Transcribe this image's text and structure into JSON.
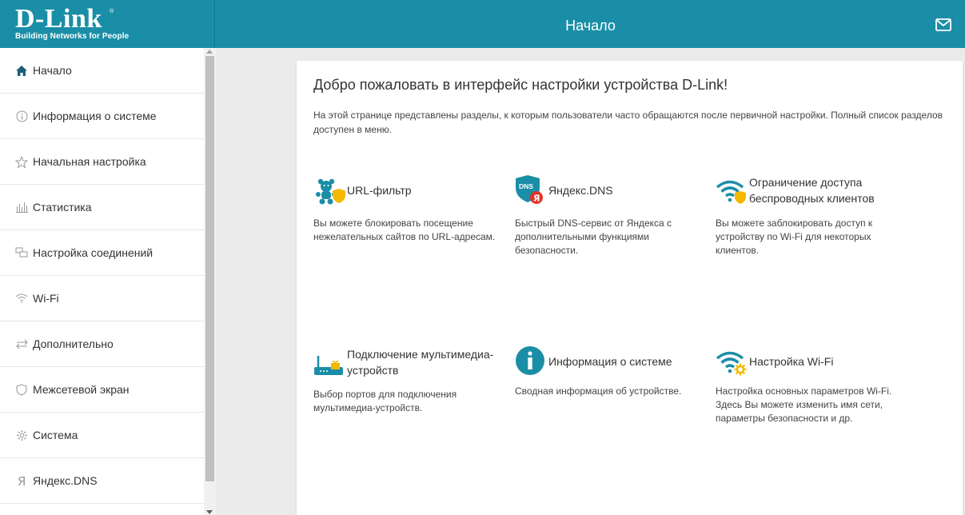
{
  "header": {
    "logo_text": "D-Link",
    "logo_tagline": "Building Networks for People",
    "logo_reg": "®",
    "title": "Начало",
    "mail_icon": "envelope-icon"
  },
  "sidebar": {
    "items": [
      {
        "label": "Начало",
        "icon": "home-icon"
      },
      {
        "label": "Информация о системе",
        "icon": "info-icon"
      },
      {
        "label": "Начальная настройка",
        "icon": "star-icon"
      },
      {
        "label": "Статистика",
        "icon": "bar-chart-icon"
      },
      {
        "label": "Настройка соединений",
        "icon": "connections-icon"
      },
      {
        "label": "Wi-Fi",
        "icon": "wifi-icon"
      },
      {
        "label": "Дополнительно",
        "icon": "arrows-icon"
      },
      {
        "label": "Межсетевой экран",
        "icon": "shield-icon"
      },
      {
        "label": "Система",
        "icon": "gear-icon"
      },
      {
        "label": "Яндекс.DNS",
        "icon": "yandex-icon"
      }
    ]
  },
  "main": {
    "title": "Добро пожаловать в интерфейс настройки устройства D-Link!",
    "description": "На этой странице представлены разделы, к которым пользователи часто обращаются после первичной настройки. Полный список разделов доступен в меню.",
    "tiles": [
      {
        "title": "URL-фильтр",
        "desc": "Вы можете блокировать посещение нежелательных сайтов по URL-адресам.",
        "icon": "url-filter-icon"
      },
      {
        "title": "Яндекс.DNS",
        "desc": "Быстрый DNS-сервис от Яндекса с дополнительными функциями безопасности.",
        "icon": "yandex-dns-icon",
        "badge": "DNS",
        "badge_letter": "Я"
      },
      {
        "title": "Ограничение доступа беспроводных клиентов",
        "desc": "Вы можете заблокировать доступ к устройству по Wi-Fi для некоторых клиентов.",
        "icon": "wifi-shield-icon"
      },
      {
        "title": "Подключение мультимедиа-устройств",
        "desc": "Выбор портов для подключения мультимедиа-устройств.",
        "icon": "multimedia-icon"
      },
      {
        "title": "Информация о системе",
        "desc": "Сводная информация об устройстве.",
        "icon": "info-circle-icon"
      },
      {
        "title": "Настройка Wi-Fi",
        "desc": "Настройка основных параметров Wi-Fi. Здесь Вы можете изменить имя сети, параметры безопасности и др.",
        "icon": "wifi-gear-icon"
      }
    ]
  },
  "colors": {
    "header_bg": "#1b8ea7",
    "accent": "#1b8ea7",
    "shield_yellow": "#f5b800",
    "yandex_red": "#e6332a"
  }
}
